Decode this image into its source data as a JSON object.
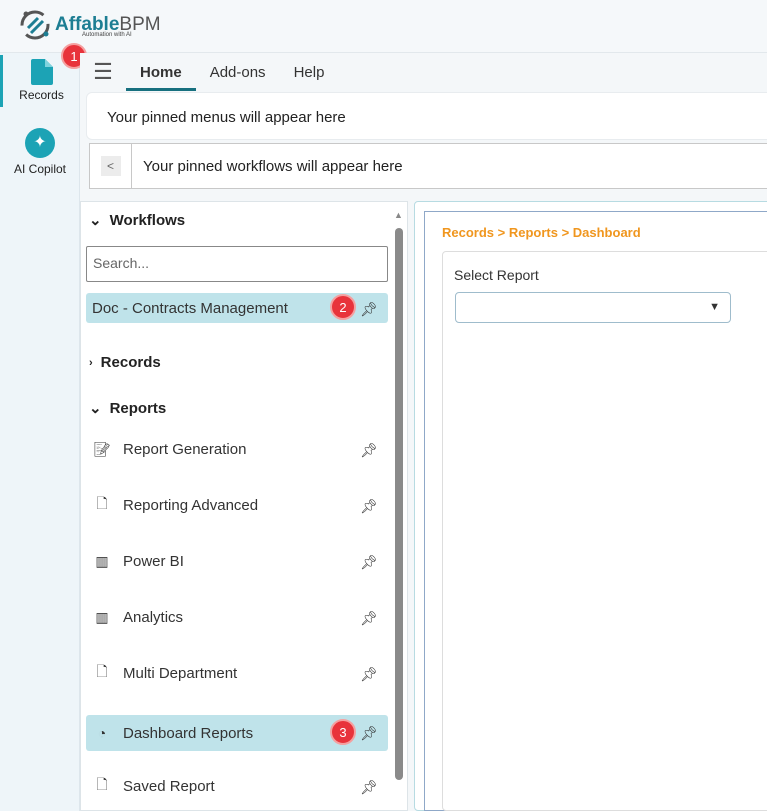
{
  "app": {
    "logo_main": "Affable",
    "logo_accent": "BPM",
    "logo_sub": "Automation with AI"
  },
  "rail": [
    {
      "label": "Records",
      "icon": "document-icon"
    },
    {
      "label": "AI Copilot",
      "icon": "sparkle-icon"
    }
  ],
  "badges": [
    "1",
    "2",
    "3"
  ],
  "tabs": [
    "Home",
    "Add-ons",
    "Help"
  ],
  "pinned_menus": "Your pinned menus will appear here",
  "pinned_workflows": "Your pinned workflows will appear here",
  "sidebar": {
    "workflows_title": "Workflows",
    "search_placeholder": "Search...",
    "workflow_items": [
      {
        "label": "Doc - Contracts Management"
      }
    ],
    "records_title": "Records",
    "reports_title": "Reports",
    "report_items": [
      {
        "label": "Report Generation"
      },
      {
        "label": "Reporting Advanced"
      },
      {
        "label": "Power BI"
      },
      {
        "label": "Analytics"
      },
      {
        "label": "Multi Department"
      },
      {
        "label": "Dashboard Reports"
      },
      {
        "label": "Saved Report"
      }
    ]
  },
  "main": {
    "breadcrumb": "Records > Reports > Dashboard",
    "select_label": "Select Report",
    "select_value": ""
  },
  "colors": {
    "accent": "#17707f",
    "breadcrumb": "#f0961e",
    "selected": "#bfe3ea",
    "badge": "#e8333b"
  }
}
